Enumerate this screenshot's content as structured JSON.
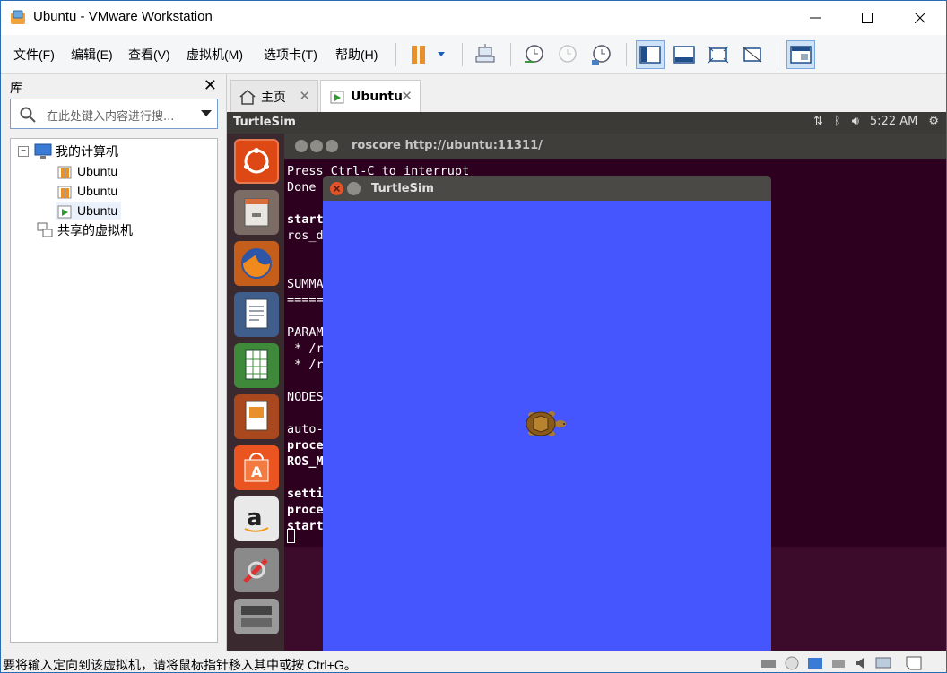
{
  "window": {
    "title": "Ubuntu - VMware Workstation"
  },
  "menu": [
    "文件(F)",
    "编辑(E)",
    "查看(V)",
    "虚拟机(M)",
    "选项卡(T)",
    "帮助(H)"
  ],
  "library": {
    "title": "库",
    "search_placeholder": "在此处键入内容进行搜...",
    "tree": {
      "root": "我的计算机",
      "vms": [
        "Ubuntu",
        "Ubuntu",
        "Ubuntu"
      ],
      "shared": "共享的虚拟机"
    }
  },
  "tabs": [
    {
      "label": "主页"
    },
    {
      "label": "Ubuntu"
    }
  ],
  "ubuntu": {
    "topbar_title": "TurtleSim",
    "clock": "5:22 AM",
    "terminal": {
      "title": "roscore http://ubuntu:11311/",
      "lines": [
        "Press Ctrl-C to interrupt",
        "Done",
        "",
        "start",
        "ros_d",
        "",
        "",
        "SUMMA",
        "=====",
        "",
        "PARAM",
        " * /r",
        " * /r",
        "",
        "NODES",
        "",
        "auto-",
        "proce",
        "ROS_M",
        "",
        "setti",
        "proce",
        "start"
      ]
    },
    "turtlesim": {
      "title": "TurtleSim"
    }
  },
  "status": {
    "message": "要将输入定向到该虚拟机，请将鼠标指针移入其中或按 Ctrl+G。"
  }
}
